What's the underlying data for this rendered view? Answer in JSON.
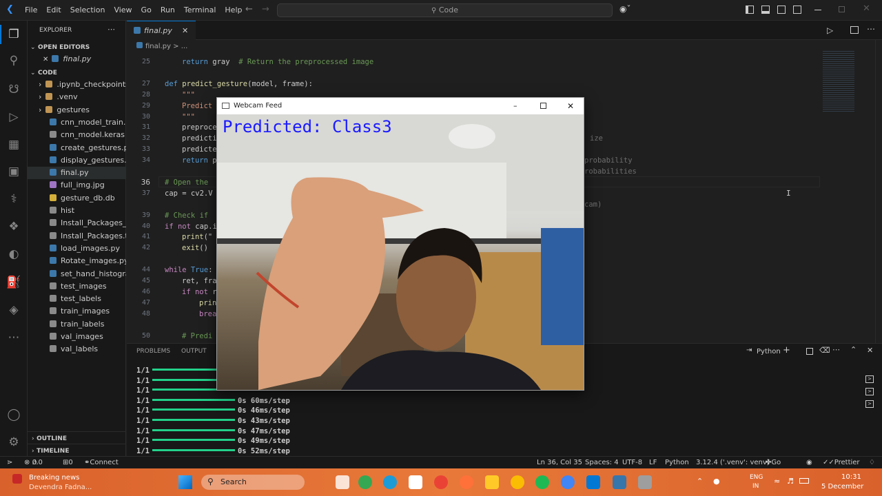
{
  "titlebar": {
    "menu": [
      "File",
      "Edit",
      "Selection",
      "View",
      "Go",
      "Run",
      "Terminal",
      "Help"
    ],
    "search_text": "Code"
  },
  "sidebar": {
    "explorer_title": "EXPLORER",
    "open_editors_title": "OPEN EDITORS",
    "open_editor_file": "final.py",
    "folder_title": "CODE",
    "items": [
      {
        "label": ".ipynb_checkpoints",
        "type": "folder"
      },
      {
        "label": ".venv",
        "type": "folder"
      },
      {
        "label": "gestures",
        "type": "folder"
      },
      {
        "label": "cnn_model_train.py",
        "type": "py"
      },
      {
        "label": "cnn_model.keras",
        "type": "file"
      },
      {
        "label": "create_gestures.py",
        "type": "py"
      },
      {
        "label": "display_gestures.py",
        "type": "py"
      },
      {
        "label": "final.py",
        "type": "py"
      },
      {
        "label": "full_img.jpg",
        "type": "img"
      },
      {
        "label": "gesture_db.db",
        "type": "db"
      },
      {
        "label": "hist",
        "type": "file"
      },
      {
        "label": "Install_Packages_...",
        "type": "file"
      },
      {
        "label": "Install_Packages.txt",
        "type": "file"
      },
      {
        "label": "load_images.py",
        "type": "py"
      },
      {
        "label": "Rotate_images.py",
        "type": "py"
      },
      {
        "label": "set_hand_histogra...",
        "type": "py"
      },
      {
        "label": "test_images",
        "type": "file"
      },
      {
        "label": "test_labels",
        "type": "file"
      },
      {
        "label": "train_images",
        "type": "file"
      },
      {
        "label": "train_labels",
        "type": "file"
      },
      {
        "label": "val_images",
        "type": "file"
      },
      {
        "label": "val_labels",
        "type": "file"
      }
    ],
    "outline_title": "OUTLINE",
    "timeline_title": "TIMELINE"
  },
  "editor": {
    "tab_label": "final.py",
    "breadcrumb": "final.py > ...",
    "current_line": "36",
    "lines": [
      {
        "n": "25",
        "indent": 1,
        "parts": [
          [
            "kw",
            "return"
          ],
          [
            "",
            " gray  "
          ],
          [
            "cm",
            "# Return the preprocessed image"
          ]
        ]
      },
      {
        "n": "",
        "indent": 0,
        "parts": [
          [
            "",
            ""
          ]
        ]
      },
      {
        "n": "27",
        "indent": 0,
        "parts": [
          [
            "kw",
            "def "
          ],
          [
            "fn",
            "predict_gesture"
          ],
          [
            "",
            "(model, frame):"
          ]
        ]
      },
      {
        "n": "28",
        "indent": 1,
        "parts": [
          [
            "pn",
            "\"\"\""
          ]
        ]
      },
      {
        "n": "29",
        "indent": 1,
        "parts": [
          [
            "pn",
            "Predict"
          ]
        ]
      },
      {
        "n": "30",
        "indent": 1,
        "parts": [
          [
            "pn",
            "\"\"\""
          ]
        ]
      },
      {
        "n": "31",
        "indent": 1,
        "parts": [
          [
            "",
            "preproce"
          ]
        ]
      },
      {
        "n": "32",
        "indent": 1,
        "parts": [
          [
            "",
            "predicti"
          ]
        ]
      },
      {
        "n": "33",
        "indent": 1,
        "parts": [
          [
            "",
            "predicte"
          ]
        ]
      },
      {
        "n": "34",
        "indent": 1,
        "parts": [
          [
            "kw",
            "return"
          ],
          [
            "",
            " p"
          ]
        ]
      },
      {
        "n": "",
        "indent": 0,
        "parts": [
          [
            "",
            ""
          ]
        ]
      },
      {
        "n": "36",
        "indent": 0,
        "parts": [
          [
            "cm",
            "# Open the"
          ]
        ]
      },
      {
        "n": "37",
        "indent": 0,
        "parts": [
          [
            "",
            "cap = cv2.V"
          ]
        ]
      },
      {
        "n": "",
        "indent": 0,
        "parts": [
          [
            "",
            ""
          ]
        ]
      },
      {
        "n": "39",
        "indent": 0,
        "parts": [
          [
            "cm",
            "# Check if"
          ]
        ]
      },
      {
        "n": "40",
        "indent": 0,
        "parts": [
          [
            "kw2",
            "if not"
          ],
          [
            "",
            " cap.i"
          ]
        ]
      },
      {
        "n": "41",
        "indent": 1,
        "parts": [
          [
            "fn",
            "print"
          ],
          [
            "",
            "(\""
          ]
        ]
      },
      {
        "n": "42",
        "indent": 1,
        "parts": [
          [
            "fn",
            "exit"
          ],
          [
            "",
            "()"
          ]
        ]
      },
      {
        "n": "",
        "indent": 0,
        "parts": [
          [
            "",
            ""
          ]
        ]
      },
      {
        "n": "44",
        "indent": 0,
        "parts": [
          [
            "kw2",
            "while"
          ],
          [
            "kw",
            " True"
          ],
          [
            "",
            ":"
          ]
        ]
      },
      {
        "n": "45",
        "indent": 1,
        "parts": [
          [
            "",
            "ret, fra"
          ]
        ]
      },
      {
        "n": "46",
        "indent": 1,
        "parts": [
          [
            "kw2",
            "if not"
          ],
          [
            "",
            " r"
          ]
        ]
      },
      {
        "n": "47",
        "indent": 2,
        "parts": [
          [
            "fn",
            "prin"
          ]
        ]
      },
      {
        "n": "48",
        "indent": 2,
        "parts": [
          [
            "kw2",
            "brea"
          ]
        ]
      },
      {
        "n": "",
        "indent": 0,
        "parts": [
          [
            "",
            ""
          ]
        ]
      },
      {
        "n": "50",
        "indent": 1,
        "parts": [
          [
            "cm",
            "# Predi"
          ]
        ]
      }
    ],
    "right_fragments": [
      {
        "row": 7,
        "text": "ize"
      },
      {
        "row": 9,
        "text": "probability"
      },
      {
        "row": 10,
        "text": "robabilities"
      },
      {
        "row": 13,
        "text": "cam)"
      }
    ]
  },
  "panel": {
    "tabs": [
      "PROBLEMS",
      "OUTPUT"
    ],
    "terminal_label": "Python",
    "lines": [
      {
        "step": "1/1",
        "time": ""
      },
      {
        "step": "1/1",
        "time": ""
      },
      {
        "step": "1/1",
        "time": ""
      },
      {
        "step": "1/1",
        "time": "0s 60ms/step"
      },
      {
        "step": "1/1",
        "time": "0s 46ms/step"
      },
      {
        "step": "1/1",
        "time": "0s 43ms/step"
      },
      {
        "step": "1/1",
        "time": "0s 47ms/step"
      },
      {
        "step": "1/1",
        "time": "0s 49ms/step"
      },
      {
        "step": "1/1",
        "time": "0s 52ms/step"
      }
    ]
  },
  "webcam": {
    "title": "Webcam Feed",
    "prediction": "Predicted: Class3"
  },
  "statusbar": {
    "errors": "0",
    "warnings": "0",
    "ports": "0",
    "connect": "Connect",
    "cursor": "Ln 36, Col 35",
    "spaces": "Spaces: 4",
    "encoding": "UTF-8",
    "eol": "LF",
    "language": "Python",
    "interpreter": "3.12.4 ('.venv': venv)",
    "golive": "Go Live",
    "prettier": "Prettier"
  },
  "taskbar": {
    "news_title": "Breaking news",
    "news_sub": "Devendra Fadna...",
    "search_label": "Search",
    "lang_top": "ENG",
    "lang_bottom": "IN",
    "time": "10:31",
    "date": "5 December"
  },
  "colors": {
    "accent": "#0078d4",
    "progress": "#23d18b",
    "prediction_text": "#1a1aff",
    "taskbar": "#e8793a"
  }
}
